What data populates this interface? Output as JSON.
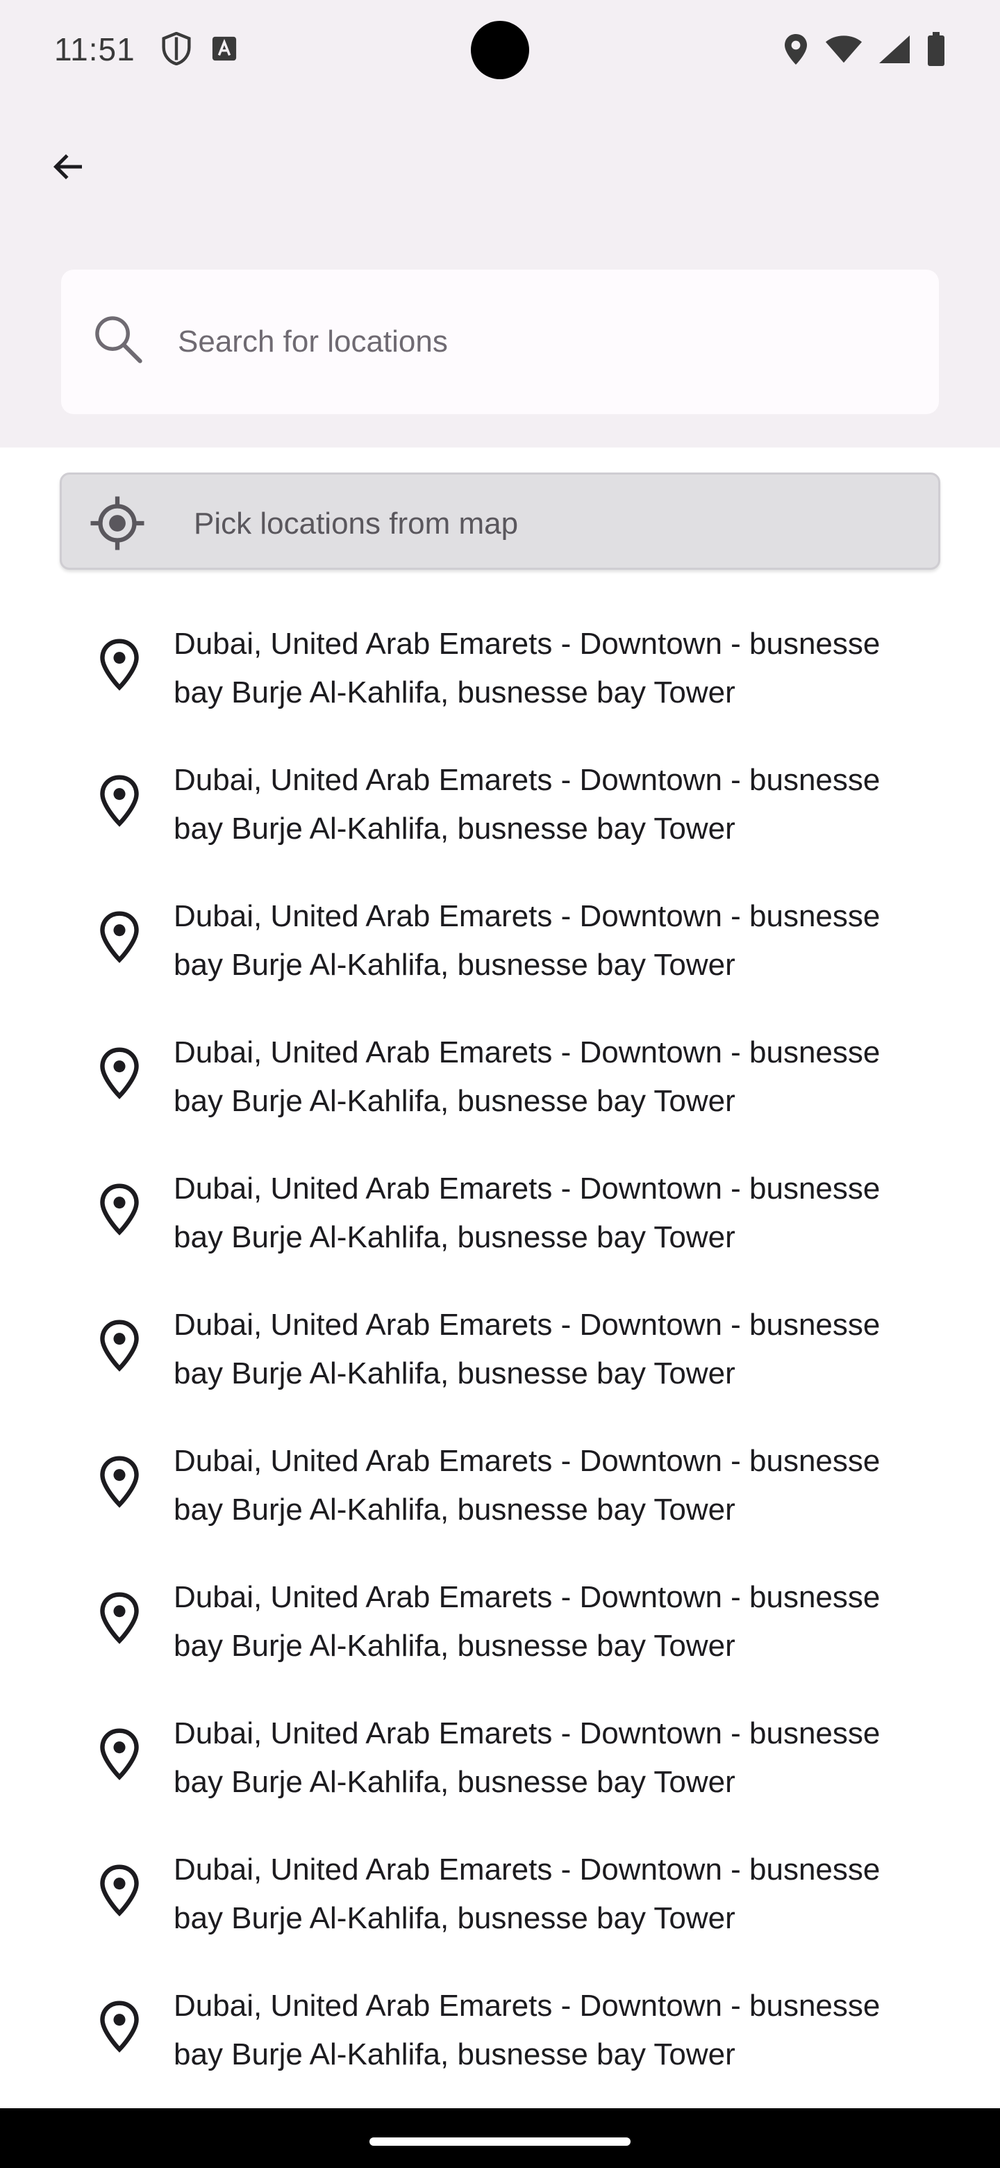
{
  "status_bar": {
    "time": "11:51",
    "left_icons": [
      "shield-icon",
      "font-icon"
    ],
    "right_icons": [
      "location-icon",
      "wifi-icon",
      "signal-icon",
      "battery-icon"
    ]
  },
  "app_bar": {
    "back_icon": "arrow-back-icon"
  },
  "search": {
    "placeholder": "Search for locations",
    "value": "",
    "icon": "search-icon"
  },
  "pick_button": {
    "label": "Pick locations from map",
    "icon": "my-location-icon"
  },
  "locations": [
    {
      "text": "Dubai, United Arab Emarets - Downtown - busnesse bay Burje Al-Kahlifa, busnesse bay Tower"
    },
    {
      "text": "Dubai, United Arab Emarets - Downtown - busnesse bay Burje Al-Kahlifa, busnesse bay Tower"
    },
    {
      "text": "Dubai, United Arab Emarets - Downtown - busnesse bay Burje Al-Kahlifa, busnesse bay Tower"
    },
    {
      "text": "Dubai, United Arab Emarets - Downtown - busnesse bay Burje Al-Kahlifa, busnesse bay Tower"
    },
    {
      "text": "Dubai, United Arab Emarets - Downtown - busnesse bay Burje Al-Kahlifa, busnesse bay Tower"
    },
    {
      "text": "Dubai, United Arab Emarets - Downtown - busnesse bay Burje Al-Kahlifa, busnesse bay Tower"
    },
    {
      "text": "Dubai, United Arab Emarets - Downtown - busnesse bay Burje Al-Kahlifa, busnesse bay Tower"
    },
    {
      "text": "Dubai, United Arab Emarets - Downtown - busnesse bay Burje Al-Kahlifa, busnesse bay Tower"
    },
    {
      "text": "Dubai, United Arab Emarets - Downtown - busnesse bay Burje Al-Kahlifa, busnesse bay Tower"
    },
    {
      "text": "Dubai, United Arab Emarets - Downtown - busnesse bay Burje Al-Kahlifa, busnesse bay Tower"
    },
    {
      "text": "Dubai, United Arab Emarets - Downtown - busnesse bay Burje Al-Kahlifa, busnesse bay Tower"
    }
  ],
  "colors": {
    "header_background": "#f3eff3",
    "search_background": "#fefbfe",
    "pick_button_background": "#e0dfe2",
    "text": "#1c1b1f"
  }
}
